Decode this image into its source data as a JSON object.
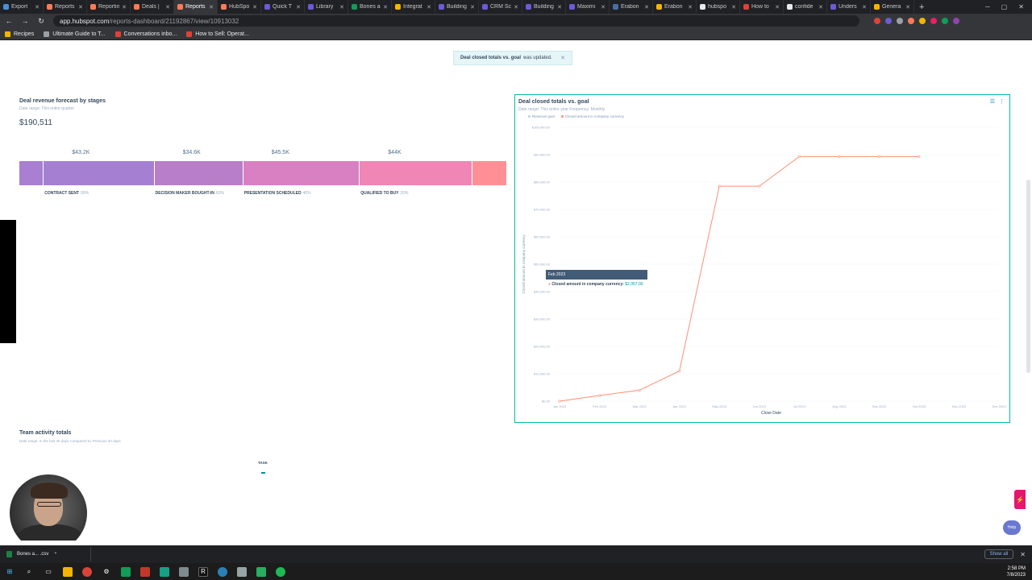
{
  "browser": {
    "tabs": [
      {
        "label": "Export",
        "color": "#4a90d9"
      },
      {
        "label": "Reports",
        "color": "#ff7a59"
      },
      {
        "label": "Reportin",
        "color": "#ff7a59"
      },
      {
        "label": "Deals |",
        "color": "#ff7a59"
      },
      {
        "label": "Reports",
        "color": "#ff7a59",
        "active": true
      },
      {
        "label": "HubSpo",
        "color": "#ff7a59"
      },
      {
        "label": "Quick T",
        "color": "#6b5bd6"
      },
      {
        "label": "Library",
        "color": "#6b5bd6"
      },
      {
        "label": "Bones a",
        "color": "#0f9d58"
      },
      {
        "label": "Integrat",
        "color": "#f4b400"
      },
      {
        "label": "Building",
        "color": "#6b5bd6"
      },
      {
        "label": "CRM Sc",
        "color": "#6b5bd6"
      },
      {
        "label": "Building",
        "color": "#6b5bd6"
      },
      {
        "label": "Maximi",
        "color": "#6b5bd6"
      },
      {
        "label": "Erabon",
        "color": "#4a6fa5"
      },
      {
        "label": "Erabon",
        "color": "#f4b400"
      },
      {
        "label": "hubspo",
        "color": "#e8eaed"
      },
      {
        "label": "How to",
        "color": "#db4437"
      },
      {
        "label": "confide",
        "color": "#e8eaed"
      },
      {
        "label": "Unders",
        "color": "#6b5bd6"
      },
      {
        "label": "Genera",
        "color": "#f4b400"
      }
    ],
    "url_host": "app.hubspot.com",
    "url_path": "/reports-dashboard/21192867/view/10913032",
    "bookmarks": [
      {
        "label": "Recipes",
        "color": "#f4b400"
      },
      {
        "label": "Ultimate Guide to T...",
        "color": "#9aa0a6"
      },
      {
        "label": "Conversations inbo...",
        "color": "#db4437"
      },
      {
        "label": "How to Sell: Operat...",
        "color": "#db4437"
      }
    ]
  },
  "toast": {
    "name": "Deal closed totals vs. goal",
    "text": "was updated."
  },
  "forecast": {
    "title": "Deal revenue forecast by stages",
    "subtitle": "Date range: This entire quarter",
    "total": "$190,511",
    "stages": [
      {
        "name": "",
        "value": "",
        "pct": "",
        "weight": 5,
        "color": "#a97fd1"
      },
      {
        "name": "CONTRACT SENT",
        "value": "$43.2K",
        "pct": "90%",
        "weight": 22.7,
        "color": "#a580d2"
      },
      {
        "name": "DECISION MAKER BOUGHT-IN",
        "value": "$34.6K",
        "pct": "60%",
        "weight": 18.2,
        "color": "#b87ec8"
      },
      {
        "name": "PRESENTATION SCHEDULED",
        "value": "$45.5K",
        "pct": "40%",
        "weight": 23.9,
        "color": "#d980c2"
      },
      {
        "name": "QUALIFIED TO BUY",
        "value": "$44K",
        "pct": "20%",
        "weight": 23.1,
        "color": "#ef86b5"
      },
      {
        "name": "",
        "value": "",
        "pct": "",
        "weight": 7.1,
        "color": "#ff8f94"
      }
    ]
  },
  "chart_card": {
    "title": "Deal closed totals vs. goal",
    "subtitle": "Date range: This entire year  Frequency: Monthly",
    "legend": [
      {
        "name": "Revenue goal",
        "color": "#c2cfdb"
      },
      {
        "name": "Closed amount in company currency",
        "color": "#ff8f73"
      }
    ],
    "tooltip_title": "Feb 2023",
    "tooltip_label": "Closed amount in company currency:",
    "tooltip_value": "$2,057.00"
  },
  "chart_data": {
    "type": "line",
    "xlabel": "Close Date",
    "ylabel": "Closed amount in company currency",
    "categories": [
      "Jan 2023",
      "Feb 2023",
      "Mar 2023",
      "Apr 2023",
      "May 2023",
      "Jun 2023",
      "Jul 2023",
      "Aug 2023",
      "Sep 2023",
      "Oct 2023",
      "Nov 2023",
      "Dec 2023"
    ],
    "y_ticks": [
      "$0.00",
      "$10,000.00",
      "$20,000.00",
      "$30,000.00",
      "$40,000.00",
      "$50,000.00",
      "$60,000.00",
      "$70,000.00",
      "$80,000.00",
      "$90,000.00",
      "$100,000.00"
    ],
    "ylim": [
      0,
      100000
    ],
    "series": [
      {
        "name": "Closed amount in company currency",
        "color": "#ff8f73",
        "values": [
          0,
          2057,
          4000,
          11000,
          78500,
          78500,
          89300,
          89300,
          89300,
          89300,
          null,
          null
        ]
      }
    ],
    "legend": "top-left",
    "grid": true
  },
  "team": {
    "title": "Team activity totals",
    "subtitle": "Date range: In the last 30 days   Compared to: Previous 30 days",
    "task_label": "TASK"
  },
  "floating": {
    "help_label": "Help"
  },
  "downloads": {
    "file": "Bones a... .csv",
    "show_all": "Show all"
  },
  "taskbar": {
    "time": "2:58 PM",
    "date": "7/8/2023"
  }
}
